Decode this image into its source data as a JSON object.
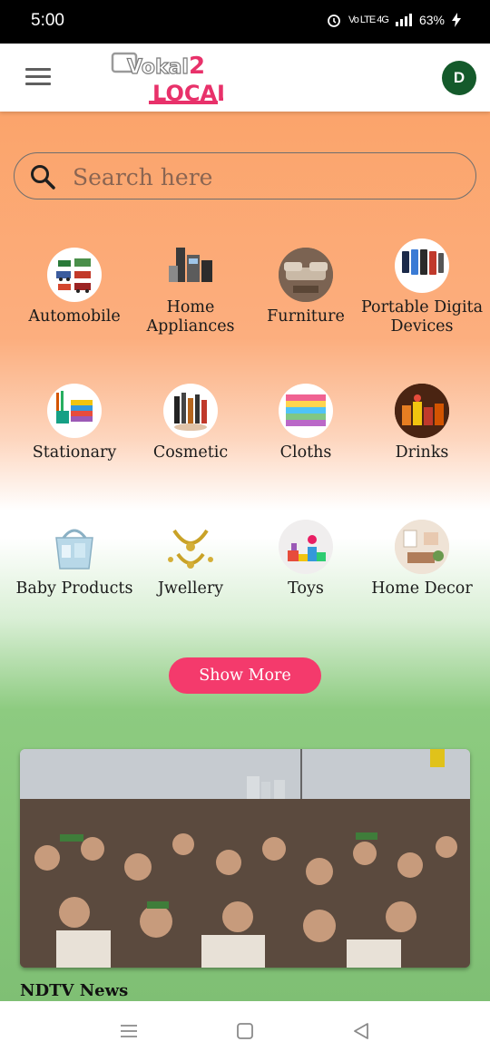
{
  "status_bar": {
    "time": "5:00",
    "network": "Vo LTE 4G",
    "battery": "63%"
  },
  "header": {
    "logo_text_top": "Vokal",
    "logo_text_2": "2",
    "logo_text_bottom": "LOCAL",
    "avatar_letter": "D",
    "colors": {
      "avatar": "#145a2b",
      "logo_pink": "#e8316a",
      "logo_grey": "#9a9a9a"
    }
  },
  "search": {
    "placeholder": "Search here",
    "value": ""
  },
  "categories": [
    {
      "label": "Automobile",
      "icon": "automobile-icon"
    },
    {
      "label": "Home Appliances",
      "icon": "home-appliances-icon"
    },
    {
      "label": "Furniture",
      "icon": "furniture-icon"
    },
    {
      "label": "Portable Digita Devices",
      "icon": "portable-devices-icon"
    },
    {
      "label": "Stationary",
      "icon": "stationary-icon"
    },
    {
      "label": "Cosmetic",
      "icon": "cosmetic-icon"
    },
    {
      "label": "Cloths",
      "icon": "cloths-icon"
    },
    {
      "label": "Drinks",
      "icon": "drinks-icon"
    },
    {
      "label": "Baby Products",
      "icon": "baby-products-icon"
    },
    {
      "label": "Jwellery",
      "icon": "jewellery-icon"
    },
    {
      "label": "Toys",
      "icon": "toys-icon"
    },
    {
      "label": "Home Decor",
      "icon": "home-decor-icon"
    }
  ],
  "show_more_label": "Show More",
  "news": {
    "source": "NDTV News",
    "image": "crowd-photo"
  },
  "colors": {
    "saffron": "#fba46b",
    "green": "#7fbf74",
    "accent_pink": "#f43a6c"
  }
}
